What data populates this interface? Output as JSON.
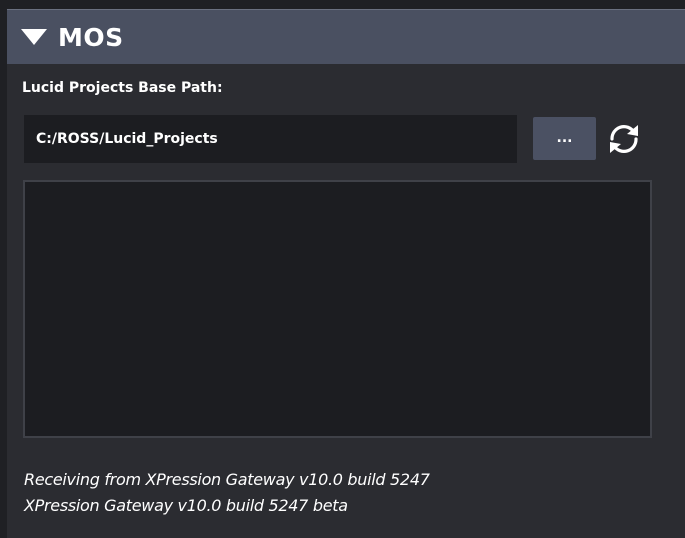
{
  "section": {
    "title": "MOS",
    "expanded": true
  },
  "path": {
    "label": "Lucid Projects Base Path:",
    "value": "C:/ROSS/Lucid_Projects",
    "browse_label": "...",
    "refresh_icon": "refresh-icon"
  },
  "list": {
    "items": []
  },
  "status": {
    "line1": "Receiving from XPression Gateway v10.0 build 5247",
    "line2": "XPression Gateway v10.0 build 5247 beta"
  },
  "colors": {
    "header_bg": "#4a5061",
    "panel_bg": "#2b2c31",
    "field_bg": "#1c1d21",
    "button_bg": "#4b5163",
    "text": "#ffffff"
  }
}
